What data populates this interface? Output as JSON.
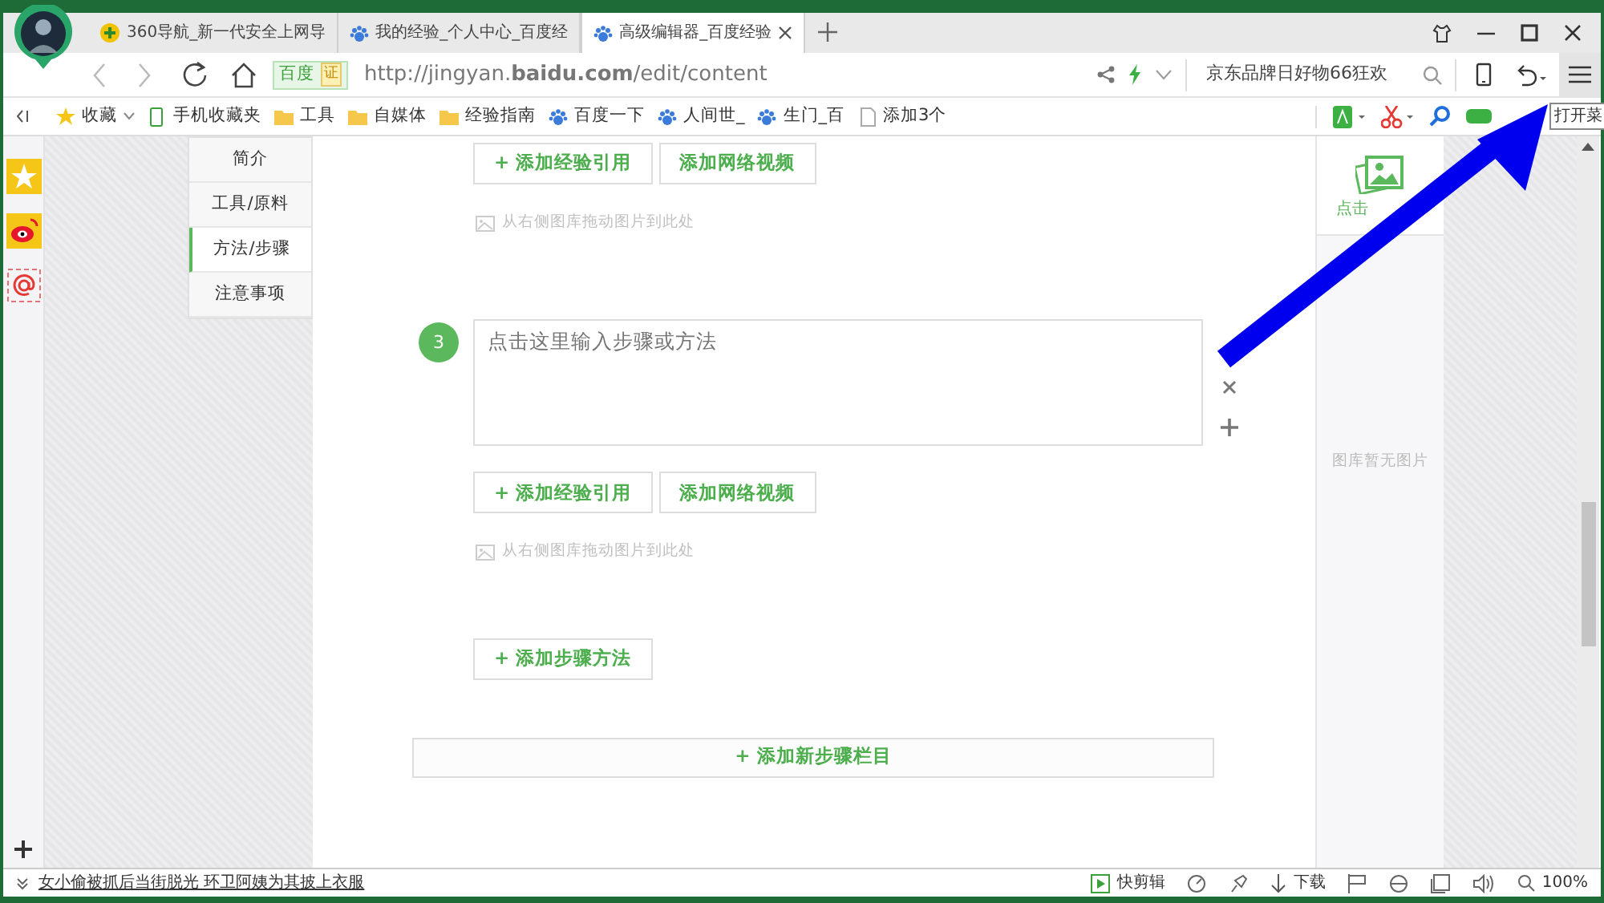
{
  "tabs": [
    {
      "title": "360导航_新一代安全上网导",
      "selected": false
    },
    {
      "title": "我的经验_个人中心_百度经",
      "selected": false
    },
    {
      "title": "高级编辑器_百度经验",
      "selected": true
    }
  ],
  "address": {
    "badge": "百度",
    "badge_cert": "证",
    "url": "http://jingyan.**baidu.com**/edit/content",
    "search_text": "京东品牌日好物66狂欢"
  },
  "tooltip": "打开菜",
  "bookmarks": [
    {
      "label": "收藏",
      "kind": "star"
    },
    {
      "label": "手机收藏夹",
      "kind": "phone"
    },
    {
      "label": "工具",
      "kind": "folder"
    },
    {
      "label": "自媒体",
      "kind": "folder"
    },
    {
      "label": "经验指南",
      "kind": "folder"
    },
    {
      "label": "百度一下",
      "kind": "paw"
    },
    {
      "label": "人间世_",
      "kind": "paw"
    },
    {
      "label": "生门_百",
      "kind": "paw"
    },
    {
      "label": "添加3个",
      "kind": "page"
    }
  ],
  "nav": [
    {
      "label": "简介",
      "selected": false
    },
    {
      "label": "工具/原料",
      "selected": false
    },
    {
      "label": "方法/步骤",
      "selected": true
    },
    {
      "label": "注意事项",
      "selected": false
    }
  ],
  "editor": {
    "sections": [
      {
        "kind": "tail",
        "buttons": [
          "+ 添加经验引用",
          "添加网络视频"
        ],
        "hint": "从右侧图库拖动图片到此处"
      },
      {
        "kind": "step",
        "number": "3",
        "placeholder": "点击这里输入步骤或方法",
        "buttons": [
          "+ 添加经验引用",
          "添加网络视频"
        ],
        "hint": "从右侧图库拖动图片到此处"
      }
    ],
    "add_step": "+ 添加步骤方法",
    "add_section": "+ 添加新步骤栏目"
  },
  "gallery": {
    "upload": "点击",
    "empty": "图库暂无图片"
  },
  "status_bar": {
    "news": "女小偷被抓后当街脱光 环卫阿姨为其披上衣服",
    "clip": "快剪辑",
    "download": "下载",
    "zoom": "100%"
  }
}
